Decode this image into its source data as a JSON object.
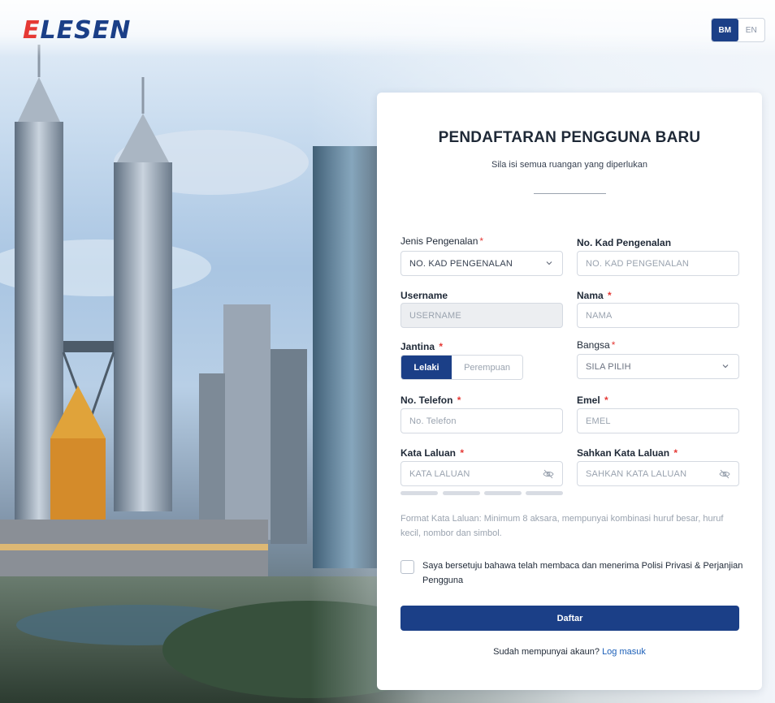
{
  "brand": {
    "logo_first": "E",
    "logo_rest": "LESEN",
    "accent": "#e53935",
    "primary": "#1b3f87"
  },
  "language": {
    "options": [
      "BM",
      "EN"
    ],
    "selected": "BM"
  },
  "form": {
    "title": "PENDAFTARAN PENGGUNA BARU",
    "subtitle": "Sila isi semua ruangan yang diperlukan",
    "fields": {
      "id_type": {
        "label": "Jenis Pengenalan",
        "required": "*",
        "value": "NO. KAD PENGENALAN",
        "icon": "chevron-down-icon"
      },
      "id_number": {
        "label": "No. Kad Pengenalan",
        "placeholder": "NO. KAD PENGENALAN"
      },
      "username": {
        "label": "Username",
        "placeholder": "USERNAME"
      },
      "name": {
        "label": "Nama",
        "required": "*",
        "placeholder": "NAMA"
      },
      "gender": {
        "label": "Jantina",
        "required": "*",
        "options": [
          "Lelaki",
          "Perempuan"
        ],
        "selected": "Lelaki"
      },
      "race": {
        "label": "Bangsa",
        "required": "*",
        "value": "SILA PILIH",
        "icon": "chevron-down-icon"
      },
      "phone": {
        "label": "No. Telefon",
        "required": "*",
        "placeholder": "No. Telefon"
      },
      "email": {
        "label": "Emel",
        "required": "*",
        "placeholder": "EMEL"
      },
      "password": {
        "label": "Kata Laluan",
        "required": "*",
        "placeholder": "KATA LALUAN",
        "icon": "eye-off-icon"
      },
      "confirm_password": {
        "label": "Sahkan Kata Laluan",
        "required": "*",
        "placeholder": "SAHKAN KATA LALUAN",
        "icon": "eye-off-icon"
      }
    },
    "password_hint": "Format Kata Laluan: Minimum 8 aksara, mempunyai kombinasi huruf besar, huruf kecil, nombor dan simbol.",
    "agreement": "Saya bersetuju bahawa telah membaca dan menerima Polisi Privasi & Perjanjian Pengguna",
    "submit_label": "Daftar",
    "login_prompt": "Sudah mempunyai akaun?",
    "login_link": "Log masuk"
  }
}
